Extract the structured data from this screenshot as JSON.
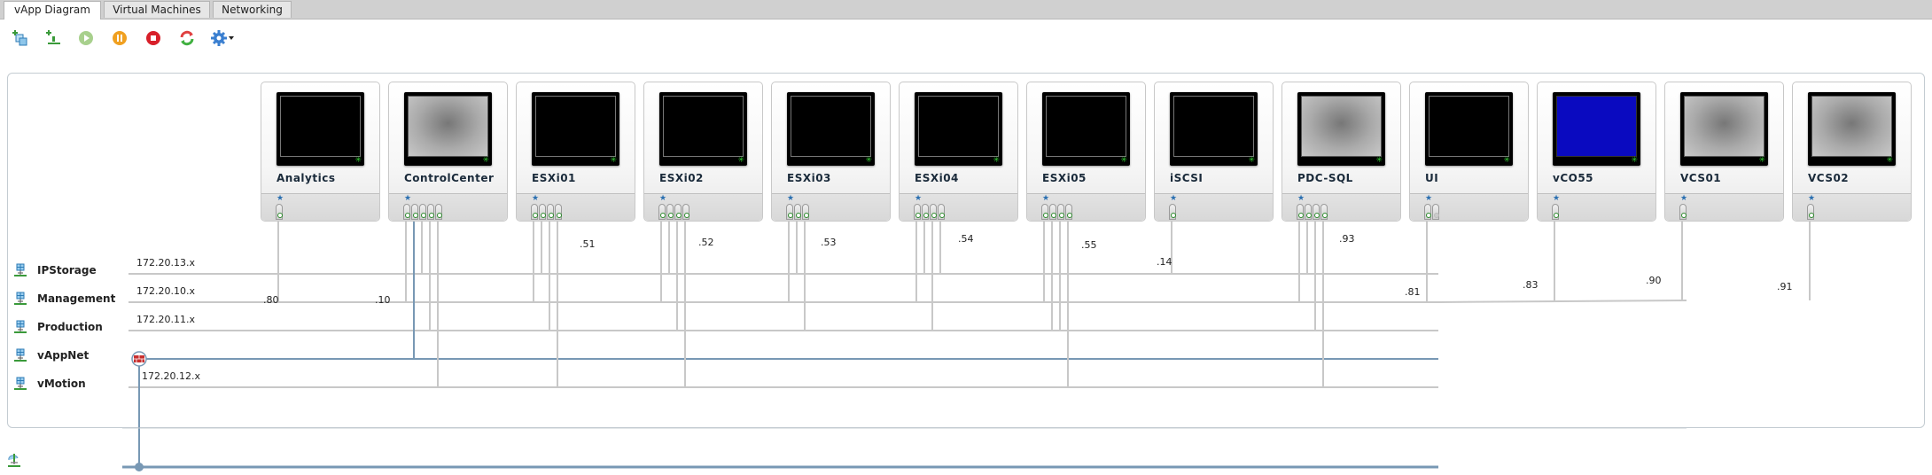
{
  "tabs": [
    {
      "label": "vApp Diagram",
      "active": true
    },
    {
      "label": "Virtual Machines",
      "active": false
    },
    {
      "label": "Networking",
      "active": false
    }
  ],
  "toolbar": [
    {
      "name": "add-vm-icon",
      "title": "Add VM"
    },
    {
      "name": "add-network-icon",
      "title": "Add Network"
    },
    {
      "name": "power-on-icon",
      "title": "Power On"
    },
    {
      "name": "suspend-icon",
      "title": "Suspend"
    },
    {
      "name": "power-off-icon",
      "title": "Power Off"
    },
    {
      "name": "reset-icon",
      "title": "Reset"
    },
    {
      "name": "gear-icon",
      "title": "Actions"
    }
  ],
  "colors": {
    "wire": "#c8c8c8",
    "vappnet_wire": "#7898b4",
    "nic_connected": "#2a8a2a"
  },
  "vms": [
    {
      "name": "Analytics",
      "screen": "black",
      "nics": [
        "Management"
      ]
    },
    {
      "name": "ControlCenter",
      "screen": "gray",
      "nics": [
        "Management",
        "vAppNet",
        "IPStorage",
        "Production",
        "vMotion"
      ]
    },
    {
      "name": "ESXi01",
      "screen": "black",
      "nics": [
        "Management",
        "IPStorage",
        "Production",
        "vMotion"
      ]
    },
    {
      "name": "ESXi02",
      "screen": "black",
      "nics": [
        "Management",
        "IPStorage",
        "Production",
        "vMotion"
      ]
    },
    {
      "name": "ESXi03",
      "screen": "black",
      "nics": [
        "Management",
        "IPStorage",
        "Production"
      ]
    },
    {
      "name": "ESXi04",
      "screen": "black",
      "nics": [
        "Management",
        "IPStorage",
        "Production",
        "IPStorage"
      ]
    },
    {
      "name": "ESXi05",
      "screen": "black",
      "nics": [
        "Management",
        "Production",
        "Production",
        "vMotion"
      ]
    },
    {
      "name": "iSCSI",
      "screen": "black",
      "nics": [
        "IPStorage"
      ]
    },
    {
      "name": "PDC-SQL",
      "screen": "gray",
      "nics": [
        "Management",
        "IPStorage",
        "Production",
        "vMotion"
      ]
    },
    {
      "name": "UI",
      "screen": "black",
      "nics": [
        "Management",
        null
      ]
    },
    {
      "name": "vCO55",
      "screen": "blue",
      "nics": [
        "Management"
      ]
    },
    {
      "name": "VCS01",
      "screen": "gray",
      "nics": [
        "Management"
      ]
    },
    {
      "name": "VCS02",
      "screen": "gray",
      "nics": [
        "Management"
      ]
    }
  ],
  "networks": [
    {
      "name": "IPStorage",
      "subnet": "172.20.13.x"
    },
    {
      "name": "Management",
      "subnet": "172.20.10.x"
    },
    {
      "name": "Production",
      "subnet": "172.20.11.x"
    },
    {
      "name": "vAppNet",
      "subnet": ""
    },
    {
      "name": "vMotion",
      "subnet": "172.20.12.x"
    }
  ],
  "ip_labels": [
    {
      "text": ".80",
      "vm": "Analytics"
    },
    {
      "text": ".10",
      "vm": "ControlCenter"
    },
    {
      "text": ".51",
      "vm": "ESXi01"
    },
    {
      "text": ".52",
      "vm": "ESXi02"
    },
    {
      "text": ".53",
      "vm": "ESXi03"
    },
    {
      "text": ".54",
      "vm": "ESXi04"
    },
    {
      "text": ".55",
      "vm": "ESXi05"
    },
    {
      "text": ".14",
      "vm": "iSCSI"
    },
    {
      "text": ".93",
      "vm": "PDC-SQL"
    },
    {
      "text": ".81",
      "vm": "UI"
    },
    {
      "text": ".83",
      "vm": "vCO55"
    },
    {
      "text": ".90",
      "vm": "VCS01"
    },
    {
      "text": ".91",
      "vm": "VCS02"
    }
  ]
}
